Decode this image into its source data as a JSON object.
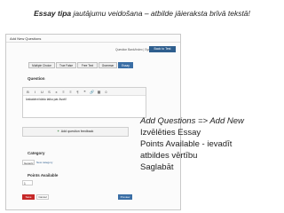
{
  "caption": {
    "part1": "Essay tipa",
    "part2": " jautājumu veidošana – ",
    "part3": "atbilde jāieraksta brīvā tekstā!"
  },
  "panel": {
    "title": "Add New Questions",
    "question_bank_link": "Question Bank/Index  |  Symbols",
    "back_button": "Back to Test"
  },
  "tabs": [
    {
      "label": "Multiple Choice"
    },
    {
      "label": "True False"
    },
    {
      "label": "Free Text"
    },
    {
      "label": "Grammar"
    },
    {
      "label": "Essay"
    }
  ],
  "question": {
    "label": "Question",
    "editor_text": "Izskaidrot kādu laiku par Avoti!",
    "toolbar": [
      "B",
      "I",
      "U",
      "S",
      "x",
      "≡",
      "≡",
      "¶",
      "❝",
      "🔗",
      "▦",
      "☺"
    ]
  },
  "feedback_button": "Add question feedback",
  "category": {
    "label": "Category",
    "selected": "Generic",
    "new_link": "New category"
  },
  "points": {
    "label": "Points Available",
    "value": "1"
  },
  "buttons": {
    "save": "Save",
    "cancel": "Cancel",
    "preview": "Preview"
  },
  "notes": {
    "line1": "Add Questions => Add New",
    "line2": "Izvēlēties Essay",
    "line3": " Points Available - ievadīt",
    "line4": "atbildes vērtību",
    "line5": "Saglabāt"
  },
  "colors": {
    "accent_blue": "#3a6ea5",
    "dark_blue": "#2e5e8e",
    "save_red": "#c62828"
  }
}
